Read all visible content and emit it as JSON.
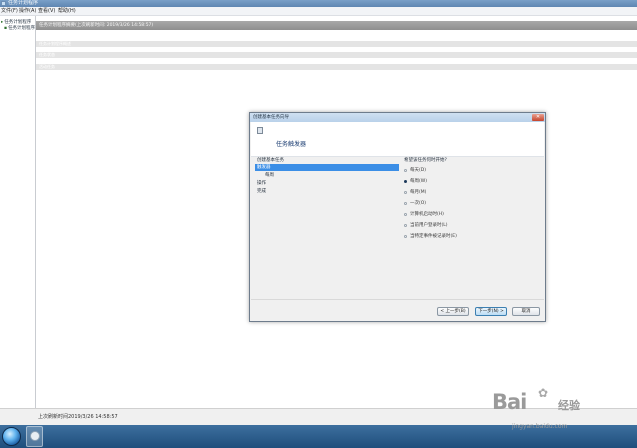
{
  "window": {
    "title": "任务计划程序"
  },
  "menu": {
    "items": [
      "文件(F)",
      "操作(A)",
      "查看(V)",
      "帮助(H)"
    ]
  },
  "tree": {
    "items": [
      "任务计划程序",
      "任务计划程序"
    ]
  },
  "main": {
    "summary_header": "任务计划程序摘要(上次刷新时间: 2019/3/26 14:58:57)",
    "sections": [
      "任务计划程序概述",
      "任务状态",
      "活动任务"
    ],
    "status_text": "上次刷新时间2019/3/26 14:58:57"
  },
  "dialog": {
    "title": "创建基本任务向导",
    "close_label": "✕",
    "heading": "任务触发器",
    "steps": [
      {
        "label": "创建基本任务",
        "active": false,
        "sub": false
      },
      {
        "label": "触发器",
        "active": true,
        "sub": false
      },
      {
        "label": "每周",
        "active": false,
        "sub": true
      },
      {
        "label": "操作",
        "active": false,
        "sub": false
      },
      {
        "label": "完成",
        "active": false,
        "sub": false
      }
    ],
    "question": "希望该任务何时开始?",
    "options": [
      {
        "label": "每天(D)",
        "selected": false
      },
      {
        "label": "每周(W)",
        "selected": true
      },
      {
        "label": "每月(M)",
        "selected": false
      },
      {
        "label": "一次(O)",
        "selected": false
      },
      {
        "label": "计算机启动时(H)",
        "selected": false
      },
      {
        "label": "当前用户登录时(L)",
        "selected": false
      },
      {
        "label": "当特定事件被记录时(E)",
        "selected": false
      }
    ],
    "buttons": {
      "back": "< 上一步(B)",
      "next": "下一步(N) >",
      "cancel": "取消"
    }
  },
  "watermark": {
    "logo": "Bai",
    "logo_cn": "经验",
    "url": "jingyan.baidu.com"
  },
  "colors": {
    "selection": "#3b8ee6",
    "heading": "#1b3d72",
    "taskbar": "#1f4e7c"
  }
}
